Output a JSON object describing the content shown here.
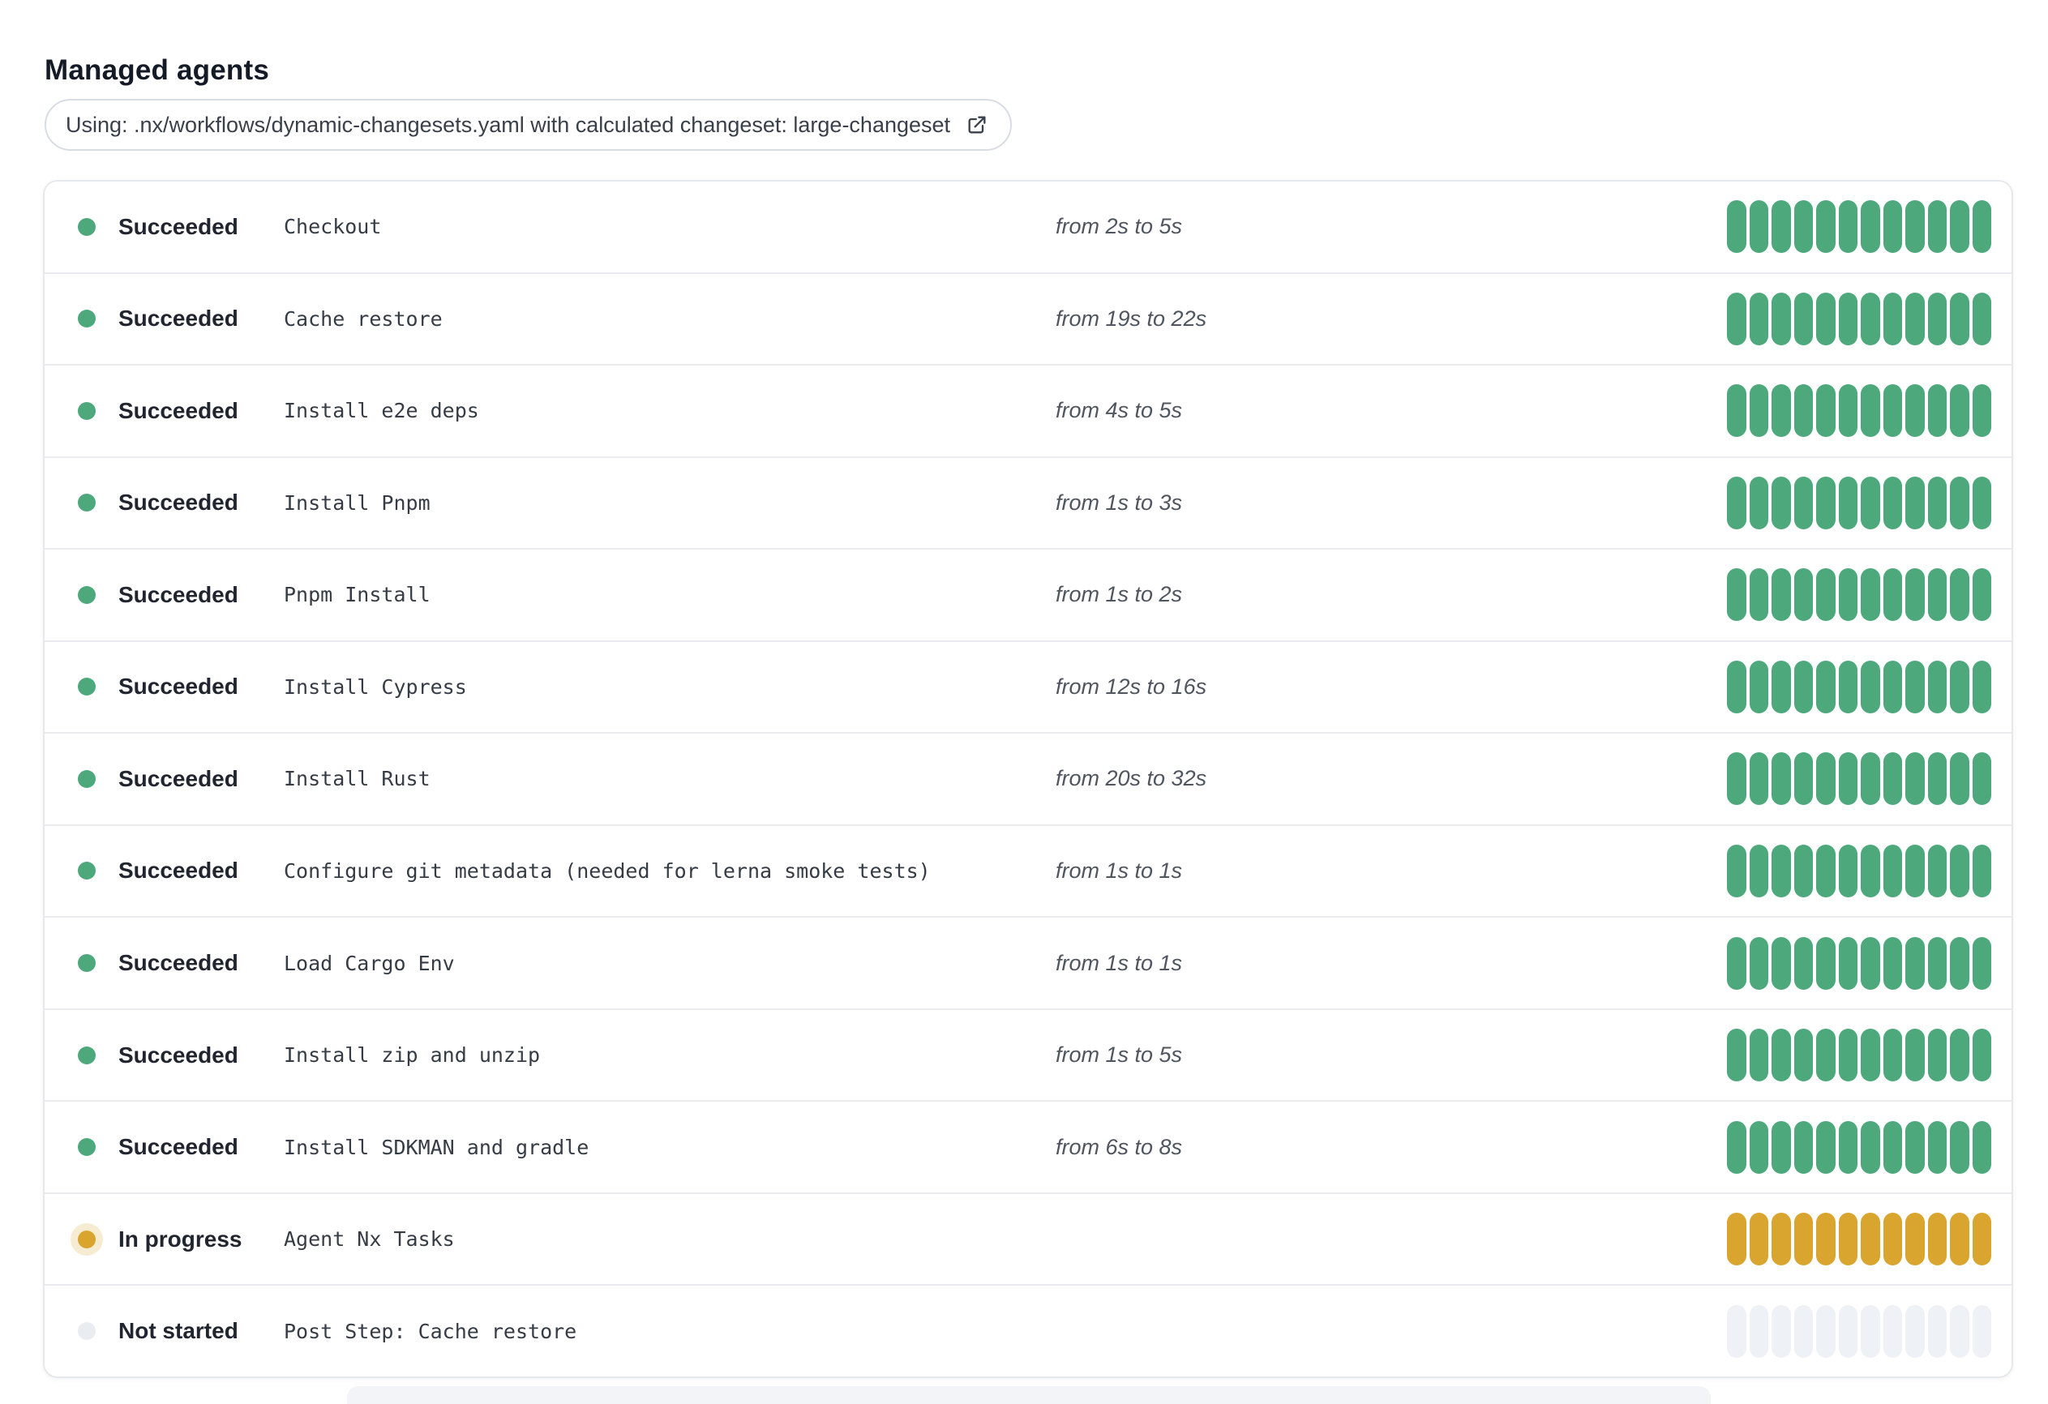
{
  "page": {
    "title": "Managed agents"
  },
  "banner": {
    "text": "Using: .nx/workflows/dynamic-changesets.yaml with calculated changeset: large-changeset",
    "icon": "external-link-icon"
  },
  "colors": {
    "succeeded": "#4DA87C",
    "in_progress": "#D9A52F",
    "in_progress_halo": "#F5ECD2",
    "not_started_dot": "#E9EDF2",
    "not_started_bar": "#EEF1F5"
  },
  "agents": {
    "bar_segments": 12,
    "rows": [
      {
        "status": "Succeeded",
        "status_key": "succeeded",
        "name": "Checkout",
        "duration": "from 2s to 5s"
      },
      {
        "status": "Succeeded",
        "status_key": "succeeded",
        "name": "Cache restore",
        "duration": "from 19s to 22s"
      },
      {
        "status": "Succeeded",
        "status_key": "succeeded",
        "name": "Install e2e deps",
        "duration": "from 4s to 5s"
      },
      {
        "status": "Succeeded",
        "status_key": "succeeded",
        "name": "Install Pnpm",
        "duration": "from 1s to 3s"
      },
      {
        "status": "Succeeded",
        "status_key": "succeeded",
        "name": "Pnpm Install",
        "duration": "from 1s to 2s"
      },
      {
        "status": "Succeeded",
        "status_key": "succeeded",
        "name": "Install Cypress",
        "duration": "from 12s to 16s"
      },
      {
        "status": "Succeeded",
        "status_key": "succeeded",
        "name": "Install Rust",
        "duration": "from 20s to 32s"
      },
      {
        "status": "Succeeded",
        "status_key": "succeeded",
        "name": "Configure git metadata (needed for lerna smoke tests)",
        "duration": "from 1s to 1s"
      },
      {
        "status": "Succeeded",
        "status_key": "succeeded",
        "name": "Load Cargo Env",
        "duration": "from 1s to 1s"
      },
      {
        "status": "Succeeded",
        "status_key": "succeeded",
        "name": "Install zip and unzip",
        "duration": "from 1s to 5s"
      },
      {
        "status": "Succeeded",
        "status_key": "succeeded",
        "name": "Install SDKMAN and gradle",
        "duration": "from 6s to 8s"
      },
      {
        "status": "In progress",
        "status_key": "in_progress",
        "name": "Agent Nx Tasks",
        "duration": ""
      },
      {
        "status": "Not started",
        "status_key": "not_started",
        "name": "Post Step: Cache restore",
        "duration": ""
      }
    ]
  }
}
